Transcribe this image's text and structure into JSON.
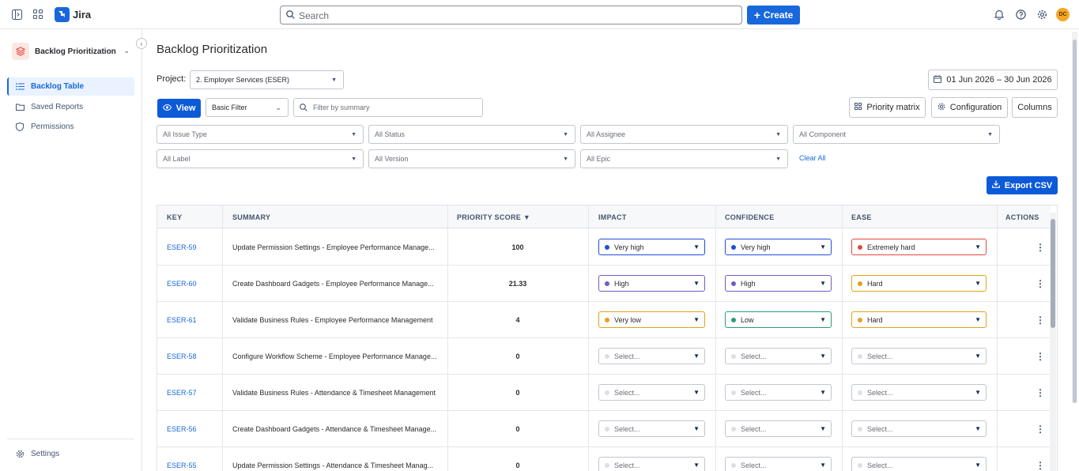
{
  "topbar": {
    "app_name": "Jira",
    "search_placeholder": "Search",
    "create_label": "Create",
    "avatar_initials": "DC"
  },
  "sidebar": {
    "project_name": "Backlog Prioritization",
    "items": [
      {
        "label": "Backlog Table",
        "icon": "list-icon",
        "active": true
      },
      {
        "label": "Saved Reports",
        "icon": "folder-icon",
        "active": false
      },
      {
        "label": "Permissions",
        "icon": "shield-icon",
        "active": false
      }
    ],
    "settings_label": "Settings"
  },
  "main": {
    "title": "Backlog Prioritization",
    "project_label": "Project:",
    "project_value": "2. Employer Services (ESER)",
    "date_range": "01 Jun 2026 – 30 Jun 2026",
    "view_label": "View",
    "filter_mode": "Basic Filter",
    "filter_placeholder": "Filter by summary",
    "priority_matrix_label": "Priority matrix",
    "configuration_label": "Configuration",
    "columns_label": "Columns",
    "filters_row1": [
      "All Issue Type",
      "All Status",
      "All Assignee",
      "All Component"
    ],
    "filters_row2": [
      "All Label",
      "All Version",
      "All Epic"
    ],
    "clear_all_label": "Clear All",
    "export_label": "Export CSV"
  },
  "table": {
    "headers": {
      "key": "KEY",
      "summary": "SUMMARY",
      "priority": "PRIORITY SCORE ▼",
      "impact": "IMPACT",
      "confidence": "CONFIDENCE",
      "ease": "EASE",
      "actions": "ACTIONS"
    },
    "rows": [
      {
        "key": "ESER-59",
        "summary": "Update Permission Settings - Employee Performance Manage...",
        "score": "100",
        "impact": {
          "label": "Very high",
          "color": "#1d4ed8"
        },
        "confidence": {
          "label": "Very high",
          "color": "#1d4ed8"
        },
        "ease": {
          "label": "Extremely hard",
          "color": "#e2483d"
        }
      },
      {
        "key": "ESER-60",
        "summary": "Create Dashboard Gadgets - Employee Performance Manage...",
        "score": "21.33",
        "impact": {
          "label": "High",
          "color": "#6e5dc6"
        },
        "confidence": {
          "label": "High",
          "color": "#6e5dc6"
        },
        "ease": {
          "label": "Hard",
          "color": "#e2a21a"
        }
      },
      {
        "key": "ESER-61",
        "summary": "Validate Business Rules - Employee Performance Management",
        "score": "4",
        "impact": {
          "label": "Very low",
          "color": "#e2a21a"
        },
        "confidence": {
          "label": "Low",
          "color": "#2a9d75"
        },
        "ease": {
          "label": "Hard",
          "color": "#e2a21a"
        }
      },
      {
        "key": "ESER-58",
        "summary": "Configure Workflow Scheme - Employee Performance Manage...",
        "score": "0",
        "impact": {
          "label": "Select...",
          "color": "#dcdfe4"
        },
        "confidence": {
          "label": "Select...",
          "color": "#dcdfe4"
        },
        "ease": {
          "label": "Select...",
          "color": "#dcdfe4"
        }
      },
      {
        "key": "ESER-57",
        "summary": "Validate Business Rules - Attendance & Timesheet Management",
        "score": "0",
        "impact": {
          "label": "Select...",
          "color": "#dcdfe4"
        },
        "confidence": {
          "label": "Select...",
          "color": "#dcdfe4"
        },
        "ease": {
          "label": "Select...",
          "color": "#dcdfe4"
        }
      },
      {
        "key": "ESER-56",
        "summary": "Create Dashboard Gadgets - Attendance & Timesheet Manage...",
        "score": "0",
        "impact": {
          "label": "Select...",
          "color": "#dcdfe4"
        },
        "confidence": {
          "label": "Select...",
          "color": "#dcdfe4"
        },
        "ease": {
          "label": "Select...",
          "color": "#dcdfe4"
        }
      },
      {
        "key": "ESER-55",
        "summary": "Update Permission Settings - Attendance & Timesheet Manag...",
        "score": "0",
        "impact": {
          "label": "Select...",
          "color": "#dcdfe4"
        },
        "confidence": {
          "label": "Select...",
          "color": "#dcdfe4"
        },
        "ease": {
          "label": "Select...",
          "color": "#dcdfe4"
        }
      }
    ]
  }
}
